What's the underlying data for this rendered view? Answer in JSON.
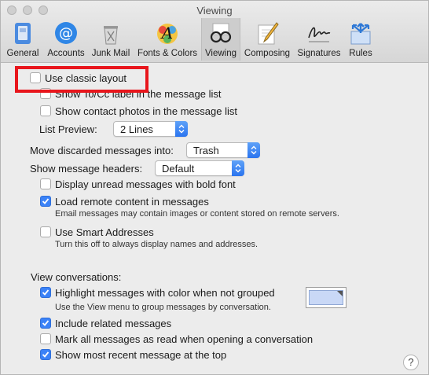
{
  "window": {
    "title": "Viewing"
  },
  "toolbar": {
    "items": [
      {
        "label": "General",
        "icon": "switch-icon"
      },
      {
        "label": "Accounts",
        "icon": "at-sign-icon"
      },
      {
        "label": "Junk Mail",
        "icon": "trash-can-icon"
      },
      {
        "label": "Fonts & Colors",
        "icon": "fonts-palette-icon"
      },
      {
        "label": "Viewing",
        "icon": "glasses-icon",
        "selected": true
      },
      {
        "label": "Composing",
        "icon": "pencil-paper-icon"
      },
      {
        "label": "Signatures",
        "icon": "signature-icon"
      },
      {
        "label": "Rules",
        "icon": "rules-arrows-icon"
      }
    ]
  },
  "options": {
    "classic_layout": {
      "label": "Use classic layout",
      "checked": false
    },
    "show_tocc": {
      "label": "Show To/Cc label in the message list",
      "checked": false
    },
    "show_photos": {
      "label": "Show contact photos in the message list",
      "checked": false
    },
    "list_preview": {
      "label": "List Preview:",
      "value": "2 Lines"
    },
    "move_discarded": {
      "label": "Move discarded messages into:",
      "value": "Trash"
    },
    "message_headers": {
      "label": "Show message headers:",
      "value": "Default"
    },
    "bold_unread": {
      "label": "Display unread messages with bold font",
      "checked": false
    },
    "remote_content": {
      "label": "Load remote content in messages",
      "checked": true,
      "note": "Email messages may contain images or content stored on remote servers."
    },
    "smart_addresses": {
      "label": "Use Smart Addresses",
      "checked": false,
      "note": "Turn this off to always display names and addresses."
    }
  },
  "conversations": {
    "heading": "View conversations:",
    "highlight": {
      "label": "Highlight messages with color when not grouped",
      "checked": true,
      "note": "Use the View menu to group messages by conversation.",
      "color": "#c9d8f6"
    },
    "include_related": {
      "label": "Include related messages",
      "checked": true
    },
    "mark_read": {
      "label": "Mark all messages as read when opening a conversation",
      "checked": false
    },
    "most_recent_top": {
      "label": "Show most recent message at the top",
      "checked": true
    }
  },
  "help": {
    "glyph": "?"
  },
  "colors": {
    "accent": "#3b82f7",
    "annotation": "#e8161c"
  }
}
